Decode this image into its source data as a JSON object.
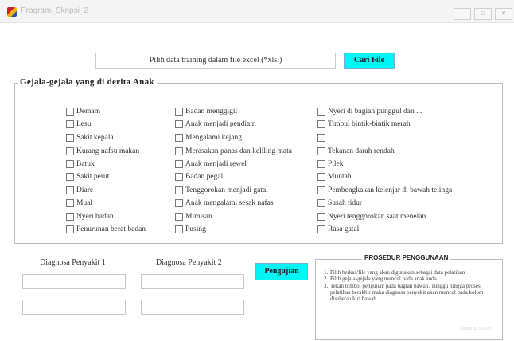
{
  "window": {
    "title": "Program_Skripsi_2",
    "controls": [
      "—",
      "□",
      "✕"
    ]
  },
  "file_select": {
    "label": "Pilih data training dalam file excel (*xlsl)",
    "button": "Cari File"
  },
  "symptoms": {
    "title": "Gejala-gejala yang di derita Anak",
    "col1": [
      "Demam",
      "Lesu",
      "Sakit kepala",
      "Kurang nafsu makan",
      "Batuk",
      "Sakit perut",
      "Diare",
      "Mual",
      "Nyeri badan",
      "Penurunan berat badan"
    ],
    "col2": [
      "Badan menggigil",
      "Anak menjadi pendiam",
      "Mengalami kejang",
      "Merasakan panas dan keliling mata",
      "Anak menjadi rewel",
      "Badan pegal",
      "Tenggorokan menjadi gatal",
      "Anak mengalami sesak nafas",
      "Mimisan",
      "Pusing"
    ],
    "col3": [
      "Nyeri di bagian punggul dan ...",
      "Timbul bintik-bintik merah",
      "",
      "Tekanan darah rendah",
      "Pilek",
      "Muntah",
      "Pembengkakan kelenjar di bawah telinga",
      "Susah tidur",
      "Nyeri tenggorokan saat menelan",
      "Rasa gatal"
    ]
  },
  "diagnosis": {
    "label1": "Diagnosa Penyakit 1",
    "label2": "Diagnosa Penyakit 2",
    "button": "Pengujian"
  },
  "procedure": {
    "title": "PROSEDUR PENGGUNAAN",
    "steps": [
      {
        "num": "1.",
        "text": "Pilih berkas/file yang akan digunakan sebagai data pelatihan"
      },
      {
        "num": "2.",
        "text": "Pilih gejala-gejala yang muncul pada anak anda"
      },
      {
        "num": "3.",
        "text": "Tekan tombol pengujian pada bagian bawah. Tunggu hingga proses pelatihan berakhir maka diagnosa penyakit akan muncul pada kolom disebelah kiri bawah"
      }
    ],
    "signature": "Lestari 16 5 2023"
  }
}
